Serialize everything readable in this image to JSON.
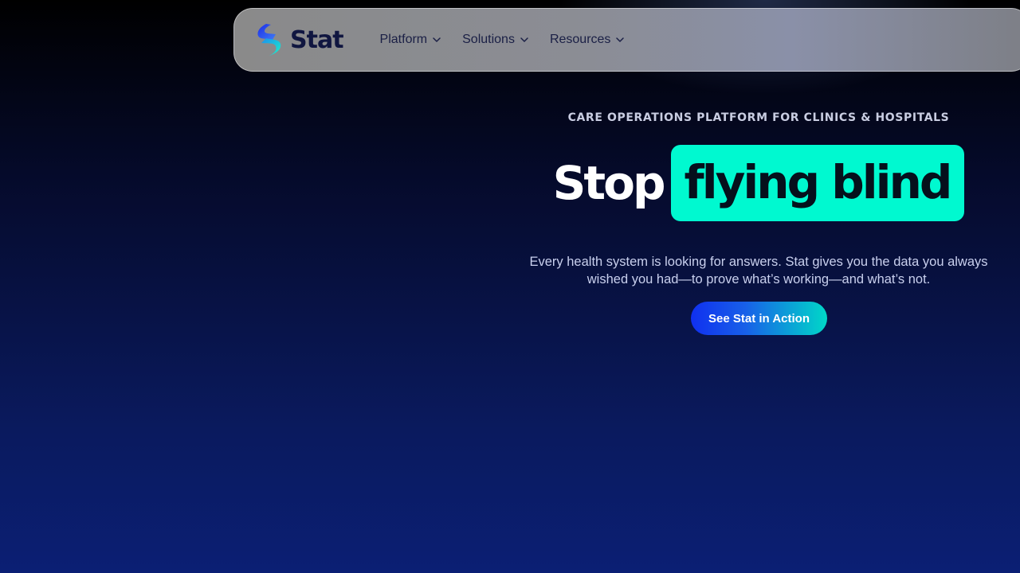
{
  "brand": {
    "name": "Stat",
    "logo_icon": "stat-s-logo",
    "colors": {
      "mark_top": "#2a4cf0",
      "mark_bottom": "#1ee6c8",
      "text": "#101640"
    }
  },
  "nav": {
    "items": [
      {
        "label": "Platform",
        "icon": "chevron-down-icon"
      },
      {
        "label": "Solutions",
        "icon": "chevron-down-icon"
      },
      {
        "label": "Resources",
        "icon": "chevron-down-icon"
      }
    ]
  },
  "hero": {
    "eyebrow": "CARE OPERATIONS PLATFORM FOR CLINICS & HOSPITALS",
    "headline_plain": "Stop",
    "headline_highlight": "flying blind",
    "subtext_line1": "Every health system is looking for answers. Stat gives you the data you always",
    "subtext_line2": "wished you had—to prove what’s working—and what’s not.",
    "cta_label": "See Stat in Action"
  },
  "colors": {
    "highlight": "#00f9d0",
    "cta_start": "#1030f0",
    "cta_end": "#00d8c8",
    "background_top": "#000000",
    "background_bottom": "#0b1f74"
  }
}
